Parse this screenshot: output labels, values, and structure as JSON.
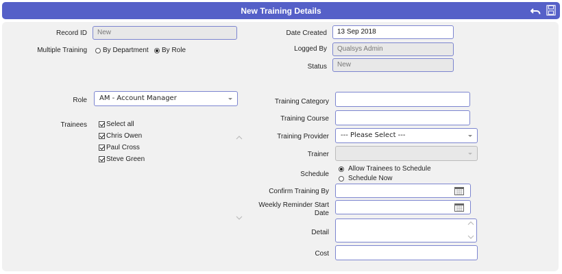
{
  "header": {
    "title": "New Training Details",
    "undo_icon": "undo-icon",
    "save_icon": "save-icon"
  },
  "form": {
    "record_id": {
      "label": "Record ID",
      "value": "New"
    },
    "multiple_training": {
      "label": "Multiple Training",
      "options": [
        "By Department",
        "By Role"
      ],
      "selected": "By Role"
    },
    "date_created": {
      "label": "Date Created",
      "value": "13 Sep 2018"
    },
    "logged_by": {
      "label": "Logged By",
      "value": "Qualsys Admin"
    },
    "status": {
      "label": "Status",
      "value": "New"
    },
    "role": {
      "label": "Role",
      "value": "AM - Account Manager"
    },
    "trainees": {
      "label": "Trainees",
      "select_all": "Select all",
      "items": [
        "Chris Owen",
        "Paul Cross",
        "Steve Green"
      ]
    },
    "training_category": {
      "label": "Training Category",
      "value": ""
    },
    "training_course": {
      "label": "Training Course",
      "value": ""
    },
    "training_provider": {
      "label": "Training Provider",
      "value": "--- Please Select ---"
    },
    "trainer": {
      "label": "Trainer",
      "value": ""
    },
    "schedule": {
      "label": "Schedule",
      "options": [
        "Allow Trainees to Schedule",
        "Schedule Now"
      ],
      "selected": "Allow Trainees to Schedule"
    },
    "confirm_training_by": {
      "label": "Confirm Training By",
      "value": ""
    },
    "weekly_reminder": {
      "label_line1": "Weekly Reminder Start",
      "label_line2": "Date",
      "value": ""
    },
    "detail": {
      "label": "Detail",
      "value": ""
    },
    "cost": {
      "label": "Cost",
      "value": ""
    }
  },
  "colors": {
    "header_bg": "#5560c8",
    "field_border": "#7b84cf",
    "panel_bg": "#f1f1f1"
  }
}
